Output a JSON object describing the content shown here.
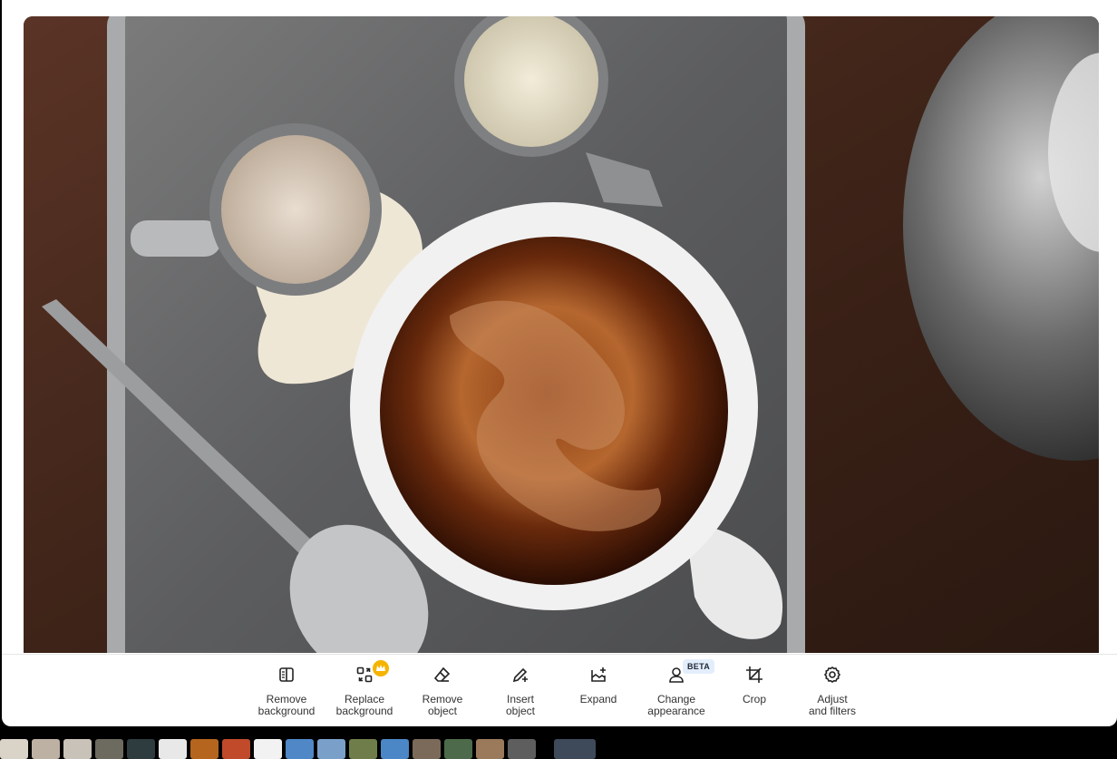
{
  "toolbar": {
    "tools": [
      {
        "label": "Remove\nbackground",
        "icon": "remove-background-icon"
      },
      {
        "label": "Replace\nbackground",
        "icon": "replace-background-icon",
        "badge": "premium-crown"
      },
      {
        "label": "Remove\nobject",
        "icon": "eraser-icon"
      },
      {
        "label": "Insert\nobject",
        "icon": "pencil-plus-icon"
      },
      {
        "label": "Expand",
        "icon": "expand-icon"
      },
      {
        "label": "Change\nappearance",
        "icon": "person-icon",
        "badge_text": "BETA"
      },
      {
        "label": "Crop",
        "icon": "crop-icon"
      },
      {
        "label": "Adjust\nand filters",
        "icon": "gear-icon"
      }
    ]
  },
  "colors": {
    "accent_crown": "#f5b400",
    "beta_bg": "#e3eefc",
    "text": "#333333"
  },
  "filmstrip": {
    "thumb_colors": [
      "#d9d3c8",
      "#bdb1a3",
      "#c9c2b8",
      "#6d6a5f",
      "#2e3b3f",
      "#e8e8e8",
      "#b5651d",
      "#c04a2a",
      "#f2f2f2",
      "#4f87c7",
      "#7aa0c9",
      "#6f7d4a",
      "#4b86c7",
      "#7b6a5a",
      "#4d6b4a",
      "#9a7a5a",
      "#5e5e5e",
      "#3e4a5a"
    ]
  }
}
